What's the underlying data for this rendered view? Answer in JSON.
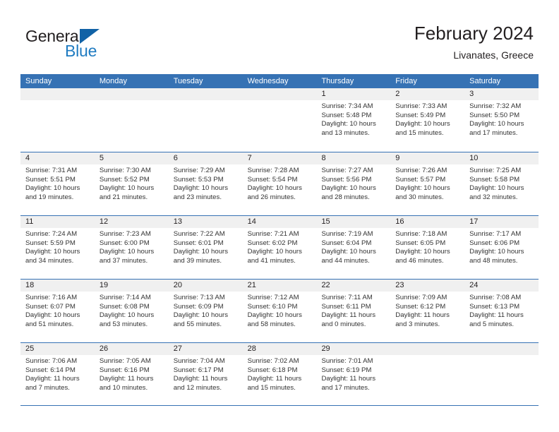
{
  "brand": {
    "word_one": "General",
    "word_two": "Blue",
    "flag_icon": "triangle-flag-icon"
  },
  "header": {
    "title": "February 2024",
    "subtitle": "Livanates, Greece"
  },
  "colors": {
    "header_blue": "#3672b4",
    "brand_blue": "#1f7bc1",
    "flag_blue": "#1162a6",
    "date_band": "#f0f0f0",
    "text": "#231f20"
  },
  "calendar": {
    "day_names": [
      "Sunday",
      "Monday",
      "Tuesday",
      "Wednesday",
      "Thursday",
      "Friday",
      "Saturday"
    ],
    "weeks": [
      [
        {
          "date": ""
        },
        {
          "date": ""
        },
        {
          "date": ""
        },
        {
          "date": ""
        },
        {
          "date": "1",
          "sunrise": "Sunrise: 7:34 AM",
          "sunset": "Sunset: 5:48 PM",
          "daylight1": "Daylight: 10 hours",
          "daylight2": "and 13 minutes."
        },
        {
          "date": "2",
          "sunrise": "Sunrise: 7:33 AM",
          "sunset": "Sunset: 5:49 PM",
          "daylight1": "Daylight: 10 hours",
          "daylight2": "and 15 minutes."
        },
        {
          "date": "3",
          "sunrise": "Sunrise: 7:32 AM",
          "sunset": "Sunset: 5:50 PM",
          "daylight1": "Daylight: 10 hours",
          "daylight2": "and 17 minutes."
        }
      ],
      [
        {
          "date": "4",
          "sunrise": "Sunrise: 7:31 AM",
          "sunset": "Sunset: 5:51 PM",
          "daylight1": "Daylight: 10 hours",
          "daylight2": "and 19 minutes."
        },
        {
          "date": "5",
          "sunrise": "Sunrise: 7:30 AM",
          "sunset": "Sunset: 5:52 PM",
          "daylight1": "Daylight: 10 hours",
          "daylight2": "and 21 minutes."
        },
        {
          "date": "6",
          "sunrise": "Sunrise: 7:29 AM",
          "sunset": "Sunset: 5:53 PM",
          "daylight1": "Daylight: 10 hours",
          "daylight2": "and 23 minutes."
        },
        {
          "date": "7",
          "sunrise": "Sunrise: 7:28 AM",
          "sunset": "Sunset: 5:54 PM",
          "daylight1": "Daylight: 10 hours",
          "daylight2": "and 26 minutes."
        },
        {
          "date": "8",
          "sunrise": "Sunrise: 7:27 AM",
          "sunset": "Sunset: 5:56 PM",
          "daylight1": "Daylight: 10 hours",
          "daylight2": "and 28 minutes."
        },
        {
          "date": "9",
          "sunrise": "Sunrise: 7:26 AM",
          "sunset": "Sunset: 5:57 PM",
          "daylight1": "Daylight: 10 hours",
          "daylight2": "and 30 minutes."
        },
        {
          "date": "10",
          "sunrise": "Sunrise: 7:25 AM",
          "sunset": "Sunset: 5:58 PM",
          "daylight1": "Daylight: 10 hours",
          "daylight2": "and 32 minutes."
        }
      ],
      [
        {
          "date": "11",
          "sunrise": "Sunrise: 7:24 AM",
          "sunset": "Sunset: 5:59 PM",
          "daylight1": "Daylight: 10 hours",
          "daylight2": "and 34 minutes."
        },
        {
          "date": "12",
          "sunrise": "Sunrise: 7:23 AM",
          "sunset": "Sunset: 6:00 PM",
          "daylight1": "Daylight: 10 hours",
          "daylight2": "and 37 minutes."
        },
        {
          "date": "13",
          "sunrise": "Sunrise: 7:22 AM",
          "sunset": "Sunset: 6:01 PM",
          "daylight1": "Daylight: 10 hours",
          "daylight2": "and 39 minutes."
        },
        {
          "date": "14",
          "sunrise": "Sunrise: 7:21 AM",
          "sunset": "Sunset: 6:02 PM",
          "daylight1": "Daylight: 10 hours",
          "daylight2": "and 41 minutes."
        },
        {
          "date": "15",
          "sunrise": "Sunrise: 7:19 AM",
          "sunset": "Sunset: 6:04 PM",
          "daylight1": "Daylight: 10 hours",
          "daylight2": "and 44 minutes."
        },
        {
          "date": "16",
          "sunrise": "Sunrise: 7:18 AM",
          "sunset": "Sunset: 6:05 PM",
          "daylight1": "Daylight: 10 hours",
          "daylight2": "and 46 minutes."
        },
        {
          "date": "17",
          "sunrise": "Sunrise: 7:17 AM",
          "sunset": "Sunset: 6:06 PM",
          "daylight1": "Daylight: 10 hours",
          "daylight2": "and 48 minutes."
        }
      ],
      [
        {
          "date": "18",
          "sunrise": "Sunrise: 7:16 AM",
          "sunset": "Sunset: 6:07 PM",
          "daylight1": "Daylight: 10 hours",
          "daylight2": "and 51 minutes."
        },
        {
          "date": "19",
          "sunrise": "Sunrise: 7:14 AM",
          "sunset": "Sunset: 6:08 PM",
          "daylight1": "Daylight: 10 hours",
          "daylight2": "and 53 minutes."
        },
        {
          "date": "20",
          "sunrise": "Sunrise: 7:13 AM",
          "sunset": "Sunset: 6:09 PM",
          "daylight1": "Daylight: 10 hours",
          "daylight2": "and 55 minutes."
        },
        {
          "date": "21",
          "sunrise": "Sunrise: 7:12 AM",
          "sunset": "Sunset: 6:10 PM",
          "daylight1": "Daylight: 10 hours",
          "daylight2": "and 58 minutes."
        },
        {
          "date": "22",
          "sunrise": "Sunrise: 7:11 AM",
          "sunset": "Sunset: 6:11 PM",
          "daylight1": "Daylight: 11 hours",
          "daylight2": "and 0 minutes."
        },
        {
          "date": "23",
          "sunrise": "Sunrise: 7:09 AM",
          "sunset": "Sunset: 6:12 PM",
          "daylight1": "Daylight: 11 hours",
          "daylight2": "and 3 minutes."
        },
        {
          "date": "24",
          "sunrise": "Sunrise: 7:08 AM",
          "sunset": "Sunset: 6:13 PM",
          "daylight1": "Daylight: 11 hours",
          "daylight2": "and 5 minutes."
        }
      ],
      [
        {
          "date": "25",
          "sunrise": "Sunrise: 7:06 AM",
          "sunset": "Sunset: 6:14 PM",
          "daylight1": "Daylight: 11 hours",
          "daylight2": "and 7 minutes."
        },
        {
          "date": "26",
          "sunrise": "Sunrise: 7:05 AM",
          "sunset": "Sunset: 6:16 PM",
          "daylight1": "Daylight: 11 hours",
          "daylight2": "and 10 minutes."
        },
        {
          "date": "27",
          "sunrise": "Sunrise: 7:04 AM",
          "sunset": "Sunset: 6:17 PM",
          "daylight1": "Daylight: 11 hours",
          "daylight2": "and 12 minutes."
        },
        {
          "date": "28",
          "sunrise": "Sunrise: 7:02 AM",
          "sunset": "Sunset: 6:18 PM",
          "daylight1": "Daylight: 11 hours",
          "daylight2": "and 15 minutes."
        },
        {
          "date": "29",
          "sunrise": "Sunrise: 7:01 AM",
          "sunset": "Sunset: 6:19 PM",
          "daylight1": "Daylight: 11 hours",
          "daylight2": "and 17 minutes."
        },
        {
          "date": ""
        },
        {
          "date": ""
        }
      ]
    ]
  }
}
